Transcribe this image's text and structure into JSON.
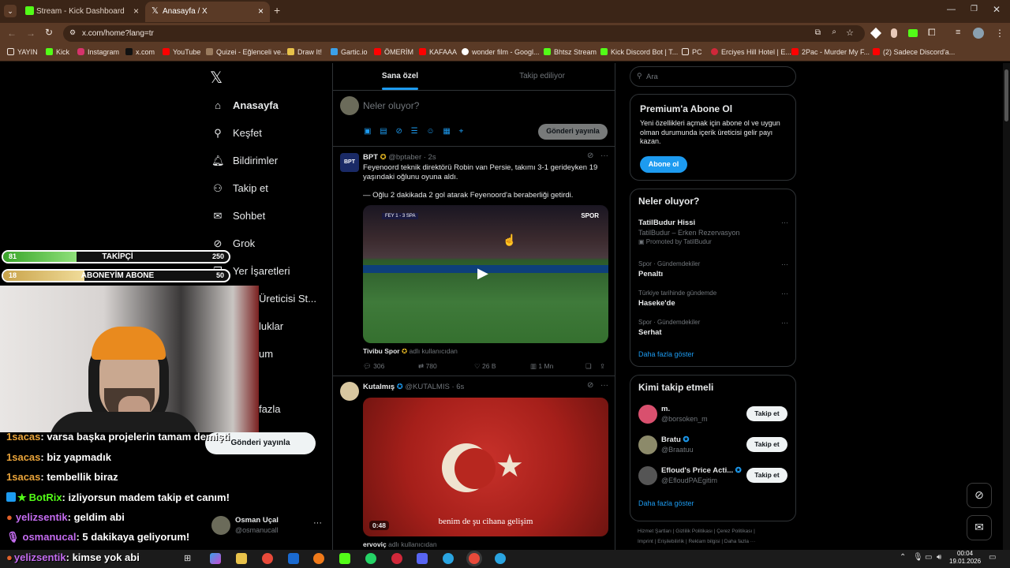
{
  "browser": {
    "tabs": [
      {
        "label": "Stream - Kick Dashboard",
        "active": false
      },
      {
        "label": "Anasayfa / X",
        "active": true
      }
    ],
    "url": "x.com/home?lang=tr",
    "bookmarks": [
      "YAYIN",
      "Kick",
      "Instagram",
      "x.com",
      "YouTube",
      "Quizei - Eğlenceli ve...",
      "Draw It!",
      "Gartic.io",
      "ÖMERİM",
      "KAFAAA",
      "wonder film - Googl...",
      "Bhtsz Stream",
      "Kick Discord Bot | T...",
      "PC",
      "Erciyes Hill Hotel | E...",
      "2Pac - Murder My F...",
      "(2) Sadece Discord'a..."
    ]
  },
  "sidebar": {
    "items": [
      {
        "label": "Anasayfa",
        "icon": "home-icon"
      },
      {
        "label": "Keşfet",
        "icon": "search-icon"
      },
      {
        "label": "Bildirimler",
        "icon": "bell-icon"
      },
      {
        "label": "Takip et",
        "icon": "follow-icon"
      },
      {
        "label": "Sohbet",
        "icon": "mail-icon"
      },
      {
        "label": "Grok",
        "icon": "grok-icon"
      },
      {
        "label": "Yer İşaretleri",
        "icon": "bookmark-icon"
      },
      {
        "label": "Üreticisi St...",
        "icon": "creator-icon"
      },
      {
        "label": "luklar",
        "icon": "community-icon"
      },
      {
        "label": "um",
        "icon": "premium-icon"
      },
      {
        "label": "fazla",
        "icon": "more-icon"
      }
    ],
    "post_button": "Gönderi yayınla",
    "account": {
      "name": "Osman Uçal",
      "handle": "@osmanucall"
    }
  },
  "feed": {
    "tabs": [
      "Sana özel",
      "Takip ediliyor"
    ],
    "compose_placeholder": "Neler oluyor?",
    "post_button": "Gönderi yayınla",
    "tweets": [
      {
        "author": "BPT",
        "handle": "@bptaber · 2s",
        "text1": "Feyenoord teknik direktörü Robin van Persie, takımı 3-1 gerideyken 19 yaşındaki oğlunu oyuna aldı.",
        "text2": "— Oğlu 2 dakikada 2 gol atarak Feyenoord'a beraberliği getirdi.",
        "video_credit": "Tivibu Spor",
        "credit_suffix": "adlı kullanıcıdan",
        "scoreboard": "FEY 1 - 3 SPA",
        "video_logo": "SPOR",
        "stats": {
          "replies": "306",
          "reposts": "780",
          "likes": "26 B",
          "views": "1 Mn"
        }
      },
      {
        "author": "Kutalmış",
        "handle": "@KUTALMIS · 6s",
        "video_caption": "benim de şu cihana gelişim",
        "duration": "0:48",
        "credit_user": "ervoviç",
        "credit_suffix": "adlı kullanıcıdan"
      }
    ]
  },
  "right": {
    "search_placeholder": "Ara",
    "premium": {
      "title": "Premium'a Abone Ol",
      "text": "Yeni özellikleri açmak için abone ol ve uygun olman durumunda içerik üreticisi gelir payı kazan.",
      "button": "Abone ol"
    },
    "trends": {
      "title": "Neler oluyor?",
      "items": [
        {
          "name": "TatilBudur Hissi",
          "meta": "TatilBudur – Erken Rezervasyon",
          "promo": "Promoted by TatilBudur"
        },
        {
          "meta": "Spor · Gündemdekiler",
          "name": "Penaltı"
        },
        {
          "meta": "Türkiye tarihinde gündemde",
          "name": "Haseke'de"
        },
        {
          "meta": "Spor · Gündemdekiler",
          "name": "Serhat"
        }
      ],
      "show_more": "Daha fazla göster"
    },
    "who_to_follow": {
      "title": "Kimi takip etmeli",
      "items": [
        {
          "name": "m.",
          "handle": "@borsoken_m",
          "button": "Takip et"
        },
        {
          "name": "Bratu",
          "handle": "@Braatuu",
          "button": "Takip et"
        },
        {
          "name": "Efloud's Price Acti...",
          "handle": "@EfloudPAEgitim",
          "button": "Takip et"
        }
      ],
      "show_more": "Daha fazla göster"
    },
    "footer": [
      "Hizmet Şartları",
      "Gizlilik Politikası",
      "Çerez Politikası",
      "Imprint",
      "Erişilebilirlik",
      "Reklam bilgisi",
      "Daha fazla ···"
    ]
  },
  "overlay": {
    "followers": {
      "label": "TAKİPÇİ",
      "current": "81",
      "goal": "250",
      "progress": 0.324
    },
    "subs": {
      "label": "ABONEYİM ABONE",
      "current": "18",
      "goal": "50",
      "progress": 0.36
    },
    "chat": [
      {
        "user": "1sacas",
        "msg": ": varsa başka projelerin tamam demişti",
        "color": "#e8a33a"
      },
      {
        "user": "1sacas",
        "msg": ": biz yapmadık",
        "color": "#e8a33a"
      },
      {
        "user": "1sacas",
        "msg": ": tembellik biraz",
        "color": "#e8a33a"
      },
      {
        "user": "BotRix",
        "msg": ": izliyorsun madem takip et canım!",
        "color": "#53fc18"
      },
      {
        "user": "yelizsentik",
        "msg": ": geldim abi",
        "color": "#c46cf0"
      },
      {
        "user": "osmanucal",
        "msg": ": 5 dakikaya geliyorum!",
        "color": "#c46cf0"
      },
      {
        "user": "yelizsentik",
        "msg": ": kimse yok abi",
        "color": "#c46cf0"
      }
    ]
  },
  "taskbar": {
    "time": "00:04",
    "date": "19.01.2026"
  }
}
